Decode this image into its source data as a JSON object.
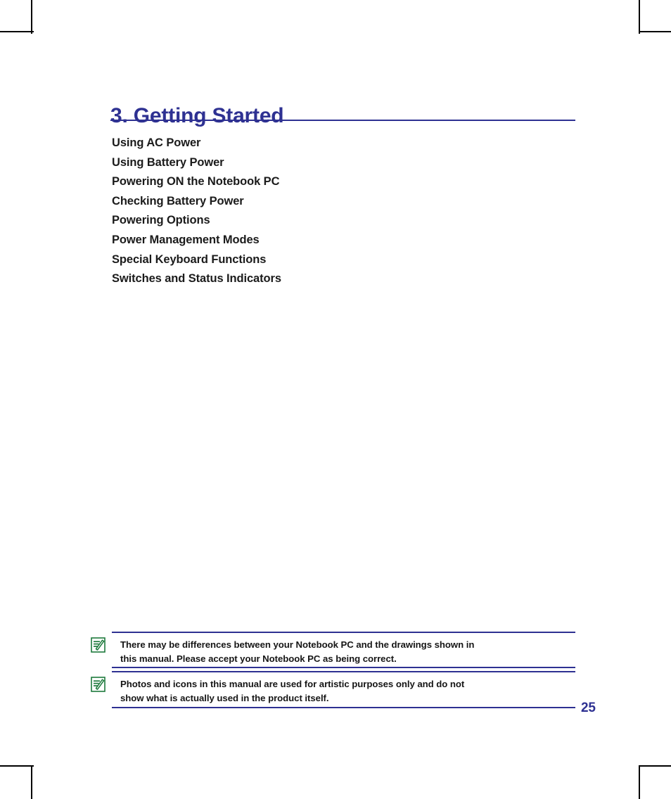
{
  "document": {
    "page_number": "25",
    "accent_color": "#2e3192",
    "note_icon_color": "#1d7a3c",
    "body_text_color": "#161616"
  },
  "chapter": {
    "title": "3. Getting Started"
  },
  "contents": [
    {
      "label": "Using AC Power"
    },
    {
      "label": "Using Battery Power"
    },
    {
      "label": "Powering ON the Notebook PC"
    },
    {
      "label": "Checking Battery Power"
    },
    {
      "label": "Powering Options"
    },
    {
      "label": "Power Management Modes"
    },
    {
      "label": "Special Keyboard Functions"
    },
    {
      "label": "Switches and Status Indicators"
    }
  ],
  "notes": [
    {
      "icon": "note-pencil-icon",
      "line1": "There may be differences between your Notebook PC and the drawings shown in",
      "line2": "this manual. Please accept your Notebook PC as being correct."
    },
    {
      "icon": "note-pencil-icon",
      "line1": "Photos and icons in this manual are used for artistic purposes only and do not",
      "line2": "show what is actually used in the product itself."
    }
  ]
}
